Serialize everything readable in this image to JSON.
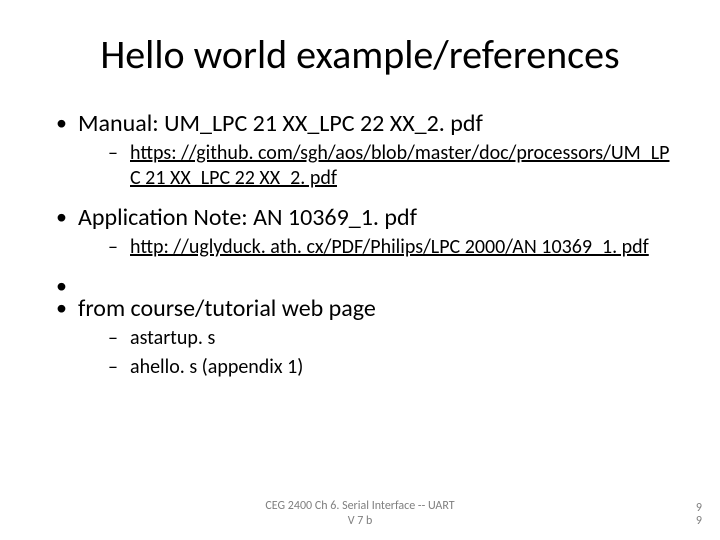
{
  "title": "Hello world example/references",
  "bullets": {
    "manual": {
      "label": "Manual: UM_LPC 21 XX_LPC 22 XX_2. pdf",
      "link": "https: //github. com/sgh/aos/blob/master/doc/processors/UM_LPC 21 XX_LPC 22 XX_2. pdf"
    },
    "appnote": {
      "label": "Application Note: AN 10369_1. pdf",
      "link": "http: //uglyduck. ath. cx/PDF/Philips/LPC 2000/AN 10369_1. pdf"
    },
    "course": {
      "label": "from course/tutorial web page",
      "items": [
        "astartup. s",
        "ahello. s (appendix 1)"
      ]
    }
  },
  "footer": {
    "line1": "CEG 2400 Ch 6. Serial Interface -- UART",
    "line2": "V 7 b"
  },
  "page": {
    "top": "9",
    "bottom": "9"
  }
}
